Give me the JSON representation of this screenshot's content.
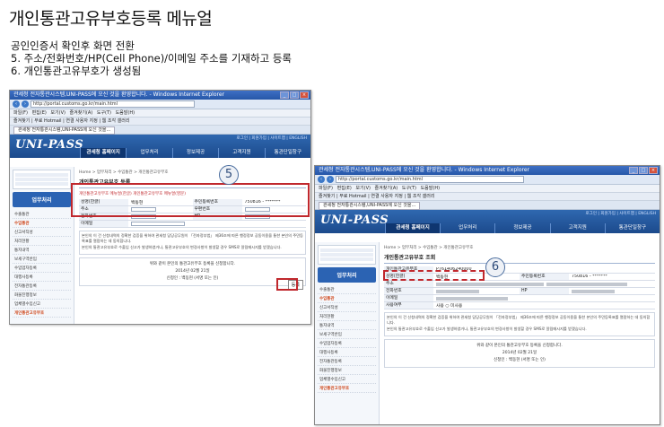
{
  "slide": {
    "title": "개인통관고유부호등록 메뉴얼",
    "lines": [
      "공인인증서 확인후 화면 전환",
      "5. 주소/전화번호/HP(Cell Phone)/이메일 주소를 기재하고 등록",
      "6. 개인통관고유부호가 생성됨"
    ]
  },
  "browser": {
    "window_title": "관세청 전자통관시스템,UNI-PASS에 오신 것을 환영합니다. - Windows Internet Explorer",
    "url": "http://portal.customs.go.kr/main.html",
    "menu": "파일(F)  편집(E)  보기(V)  즐겨찾기(A)  도구(T)  도움말(H)",
    "favorites": "즐겨찾기  |  무료 Hotmail  |  연결 사용자 지정  |  웹 조각 갤러리",
    "tab": "관세청 전자통관시스템,UNI-PASS에 오신 것을..."
  },
  "portal": {
    "logo": "UNI-PASS",
    "top_links": "로그인 | 회원가입 | 사이트맵 | ENGLISH",
    "nav": [
      "관세청 홈페이지",
      "업무처리",
      "정보제공",
      "고객지원",
      "통관단일창구"
    ],
    "side_title": "업무처리",
    "side_items": [
      "수출통관",
      "수입통관",
      "신고서작성",
      "처리현황",
      "통지내역",
      "보세구역반입",
      "수입업자등록",
      "대행사등록",
      "전자통관등록",
      "화물진행정보",
      "업체별수입신고",
      "개인통관고유부호"
    ],
    "breadcrumb": "Home > 업무처리 > 수입통관 > 개인통관고유부호",
    "agree_text": "위와 같이 본인의 통관고유부호 등록을 신청합니다.",
    "date_text": "2014년 02월 21일",
    "signer": "신청인 : 백동현 (서명 또는 인)"
  },
  "left_shot": {
    "callout": "5",
    "page_title": "개인통관고유부호 등록",
    "sub_note": "개인통관고유부호 메뉴얼(한글)   개인통관고유부호 메뉴얼(영문)",
    "rows": [
      {
        "label": "성명(한글)",
        "value": "백동현",
        "label2": "주민등록번호",
        "value2": "750816 - *******"
      },
      {
        "label": "주소",
        "value": "",
        "label2": "우편번호",
        "value2": ""
      },
      {
        "label": "전화번호",
        "value": "",
        "label2": "HP",
        "value2": ""
      },
      {
        "label": "이메일",
        "value": "",
        "label2": "",
        "value2": ""
      }
    ],
    "notice": [
      "본인의 이 건 신청내역의 정확한 검증을 위하여 관세청 담당공무원이 「전자정부법」 제36조에 따른 행정정보 공동이용을 통한 본인의 주민등록표를 열람하는 데 동의합니다.",
      "본인의 통관고유부호로 수출입 신고가 발생하였거나, 통관고유부호의 변경사항이 발생할 경우 SMS로 알림메시지를 받겠습니다."
    ],
    "confirm_label": "등록"
  },
  "right_shot": {
    "callout": "6",
    "page_title": "개인통관고유부호 조회",
    "code_label": "개인통관고유부호",
    "code_value": "P761406240000",
    "rows": [
      {
        "label": "성명(한글)",
        "value": "백동현",
        "label2": "주민등록번호",
        "value2": "750816 - *******"
      },
      {
        "label": "주소",
        "value": "",
        "label2": "",
        "value2": ""
      },
      {
        "label": "전화번호",
        "value": "",
        "label2": "HP",
        "value2": ""
      },
      {
        "label": "이메일",
        "value": "",
        "label2": "",
        "value2": ""
      },
      {
        "label": "사용여부",
        "value": "사용  ○ 미사용",
        "label2": "",
        "value2": ""
      }
    ],
    "notice": [
      "본인의 이 건 신청내역의 정확한 검증을 위하여 관세청 담당공무원이 「전자정부법」 제36조에 따른 행정정보 공동이용을 통한 본인의 주민등록표를 열람하는 데 동의합니다.",
      "본인의 통관고유부호로 수출입 신고가 발생하였거나, 통관고유부호의 변경사항이 발생할 경우 SMS로 알림메시지를 받겠습니다."
    ]
  },
  "colors": {
    "highlight": "#c0282d",
    "portal_blue": "#1c4a8c",
    "callout_border": "#4b6e9f"
  }
}
